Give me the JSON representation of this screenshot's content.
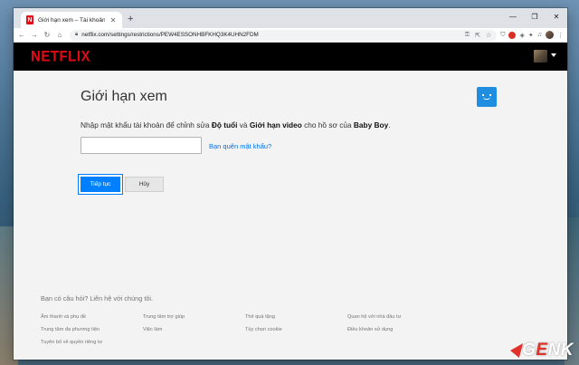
{
  "browser": {
    "tab_title": "Giới hạn xem – Tài khoản – Netfl…",
    "url": "netflix.com/settings/restrictions/PEW4ESSONHBFKHQ3K4UHN2FDM",
    "new_tab_symbol": "+",
    "win_minimize": "—",
    "win_restore": "❐",
    "win_close": "✕"
  },
  "netflix": {
    "logo": "NETFLIX"
  },
  "page": {
    "title": "Giới hạn xem",
    "instruction_prefix": "Nhập mật khẩu tài khoản để chỉnh sửa ",
    "instruction_bold1": "Độ tuổi",
    "instruction_mid": " và ",
    "instruction_bold2": "Giới hạn video",
    "instruction_mid2": " cho hồ sơ của ",
    "instruction_bold3": "Baby Boy",
    "instruction_end": ".",
    "password_value": "",
    "forgot_link": "Bạn quên mật khẩu?",
    "next_button": "Tiếp tục",
    "cancel_button": "Hủy"
  },
  "footer": {
    "question": "Bạn có câu hỏi? Liên hệ với chúng tôi.",
    "links": [
      "Âm thanh và phụ đề",
      "Trung tâm trợ giúp",
      "Thẻ quà tặng",
      "Quan hệ với nhà đầu tư",
      "Trung tâm đa phương tiện",
      "Việc làm",
      "Tùy chọn cookie",
      "Điều khoản sử dụng",
      "Tuyên bố về quyền riêng tư"
    ]
  },
  "watermark": {
    "letter_g": "G",
    "letter_e": "E",
    "letters_nk": "NK"
  },
  "colors": {
    "netflix_red": "#e50914",
    "link_blue": "#0071eb",
    "button_blue": "#0080ff",
    "kid_avatar": "#1f8ee0"
  }
}
